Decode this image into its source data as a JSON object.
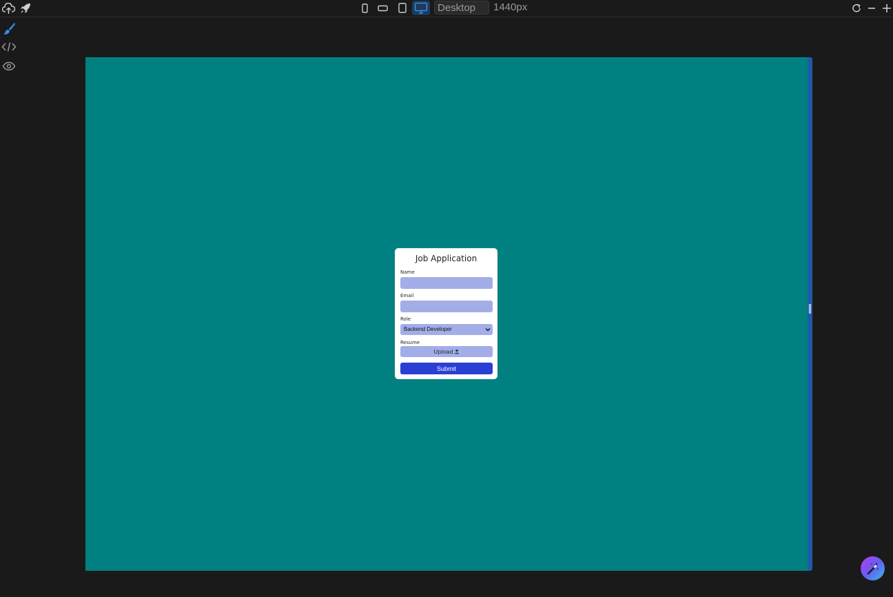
{
  "toolbar": {
    "device_options": [
      "mobile",
      "mobile-landscape",
      "tablet",
      "desktop"
    ],
    "active_device": "desktop",
    "device_label": "Desktop",
    "width_readout": "1440px"
  },
  "sidebar": {
    "tools": [
      "brush-icon",
      "code-icon",
      "eye-icon"
    ],
    "active_tool": "brush-icon"
  },
  "form": {
    "title": "Job Application",
    "name_label": "Name",
    "name_value": "",
    "email_label": "Email",
    "email_value": "",
    "role_label": "Role",
    "role_selected": "Backend Developer",
    "resume_label": "Resume",
    "upload_label": "Upload",
    "submit_label": "Submit"
  },
  "colors": {
    "canvas_bg": "#008080",
    "input_bg": "#a3aee8",
    "submit_bg": "#2a3fd4",
    "accent": "#2f8ef0"
  }
}
